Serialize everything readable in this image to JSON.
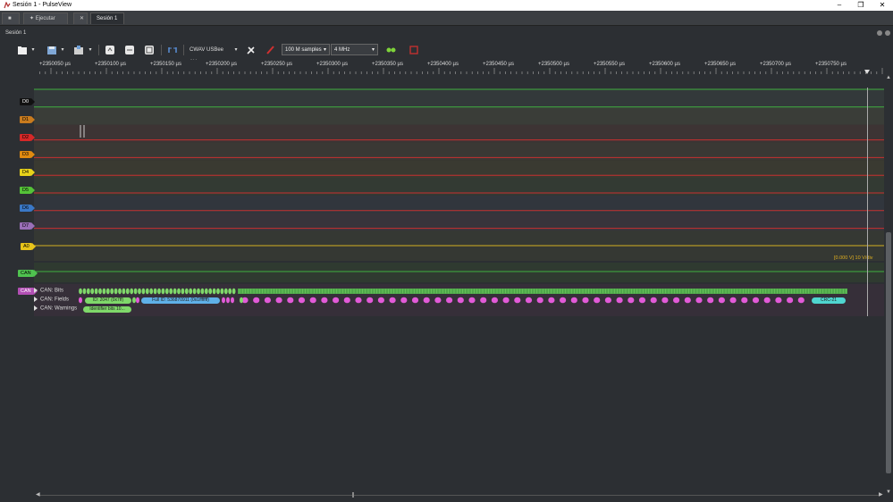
{
  "window": {
    "title": "Sesión 1 - PulseView",
    "minimize": "–",
    "maximize": "❐",
    "close": "✕"
  },
  "tabs": [
    {
      "label": "■"
    },
    {
      "label": "✦ Ejecutar"
    },
    {
      "label": "✕"
    },
    {
      "label": "Sesión 1"
    }
  ],
  "session": {
    "label": "Sesión 1"
  },
  "toolbar": {
    "device": "CWAV USBee AX",
    "samples": "100 M samples",
    "rate": "4 MHz"
  },
  "ruler": {
    "ticks": [
      "+2350050 µs",
      "+2350100 µs",
      "+2350150 µs",
      "+2350200 µs",
      "+2350250 µs",
      "+2350300 µs",
      "+2350350 µs",
      "+2350400 µs",
      "+2350450 µs",
      "+2350500 µs",
      "+2350550 µs",
      "+2350600 µs",
      "+2350650 µs",
      "+2350700 µs",
      "+2350750 µs"
    ]
  },
  "channels": [
    {
      "label": "D0",
      "color": "#111111",
      "text": "#ffffff"
    },
    {
      "label": "D1",
      "color": "#c87b1e",
      "text": "#000000"
    },
    {
      "label": "D2",
      "color": "#d62828",
      "text": "#000000"
    },
    {
      "label": "D3",
      "color": "#e08a10",
      "text": "#000000"
    },
    {
      "label": "D4",
      "color": "#e8d21a",
      "text": "#000000"
    },
    {
      "label": "D5",
      "color": "#55c238",
      "text": "#000000"
    },
    {
      "label": "D6",
      "color": "#3a78c6",
      "text": "#000000"
    },
    {
      "label": "D7",
      "color": "#9a6fb8",
      "text": "#000000"
    }
  ],
  "analog": {
    "label": "A0",
    "color": "#e8c41a",
    "readout": "[0.000 V] 10 V/div"
  },
  "can_group": {
    "label": "CAN",
    "color": "#4fc24f"
  },
  "decoder": {
    "label": "CAN",
    "color": "#b24fb4",
    "rows": [
      "CAN: Bits",
      "CAN: Fields",
      "CAN: Warnings"
    ],
    "fields": {
      "id": "ID: 2047 (0x7ff)",
      "full_id": "Full ID: 536870911 (0x1fffffff)",
      "crc": "CRC-21",
      "warning": "Identifier bits 10..."
    }
  }
}
